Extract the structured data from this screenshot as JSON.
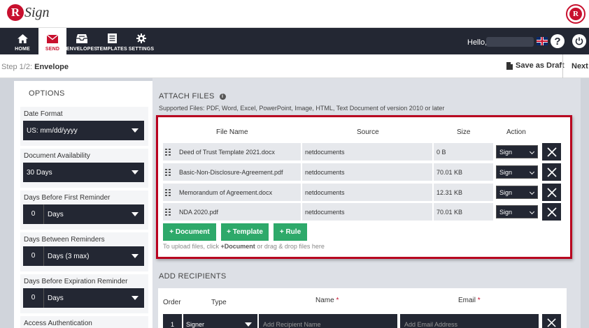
{
  "brand": {
    "logo_letter": "R",
    "logo_text": "Sign",
    "seal_letter": "R",
    "accent": "#c8102e",
    "dark": "#232733",
    "green": "#2ea96a"
  },
  "nav": {
    "items": [
      {
        "label": "HOME",
        "icon": "home-icon"
      },
      {
        "label": "SEND",
        "icon": "envelope-icon",
        "active": true
      },
      {
        "label": "ENVELOPES",
        "icon": "inbox-icon"
      },
      {
        "label": "TEMPLATES",
        "icon": "document-icon"
      },
      {
        "label": "SETTINGS",
        "icon": "gear-icon"
      }
    ],
    "greeting": "Hello,"
  },
  "stepbar": {
    "step_prefix": "Step 1/2:",
    "step_name": "Envelope",
    "save_label": "Save as Draft",
    "next_label": "Next"
  },
  "options": {
    "title": "OPTIONS",
    "groups": [
      {
        "label": "Date Format",
        "value": "US: mm/dd/yyyy"
      },
      {
        "label": "Document Availability",
        "value": "30 Days"
      },
      {
        "label": "Days Before First Reminder",
        "num": "0",
        "value": "Days"
      },
      {
        "label": "Days Between Reminders",
        "num": "0",
        "value": "Days (3 max)"
      },
      {
        "label": "Days Before Expiration Reminder",
        "num": "0",
        "value": "Days"
      },
      {
        "label": "Access Authentication"
      }
    ]
  },
  "attach": {
    "title": "ATTACH FILES",
    "supported": "Supported Files: PDF, Word, Excel, PowerPoint, Image, HTML, Text Document of version 2010 or later",
    "headers": {
      "file_name": "File Name",
      "source": "Source",
      "size": "Size",
      "action": "Action"
    },
    "files": [
      {
        "name": "Deed of Trust Template 2021.docx",
        "source": "netdocuments",
        "size": "0 B",
        "action": "Sign"
      },
      {
        "name": "Basic-Non-Disclosure-Agreement.pdf",
        "source": "netdocuments",
        "size": "70.01 KB",
        "action": "Sign"
      },
      {
        "name": "Memorandum of Agreement.docx",
        "source": "netdocuments",
        "size": "12.31 KB",
        "action": "Sign"
      },
      {
        "name": "NDA 2020.pdf",
        "source": "netdocuments",
        "size": "70.01 KB",
        "action": "Sign"
      }
    ],
    "buttons": {
      "document": "+ Document",
      "template": "+ Template",
      "rule": "+ Rule"
    },
    "hint_pre": "To upload files, click ",
    "hint_bold": "+Document",
    "hint_post": " or drag & drop files here"
  },
  "recipients": {
    "title": "ADD RECIPIENTS",
    "headers": {
      "order": "Order",
      "type": "Type",
      "name": "Name",
      "email": "Email",
      "required_mark": "*"
    },
    "row": {
      "order": "1",
      "type": "Signer",
      "name_placeholder": "Add Recipient Name",
      "email_placeholder": "Add Email Address"
    }
  }
}
